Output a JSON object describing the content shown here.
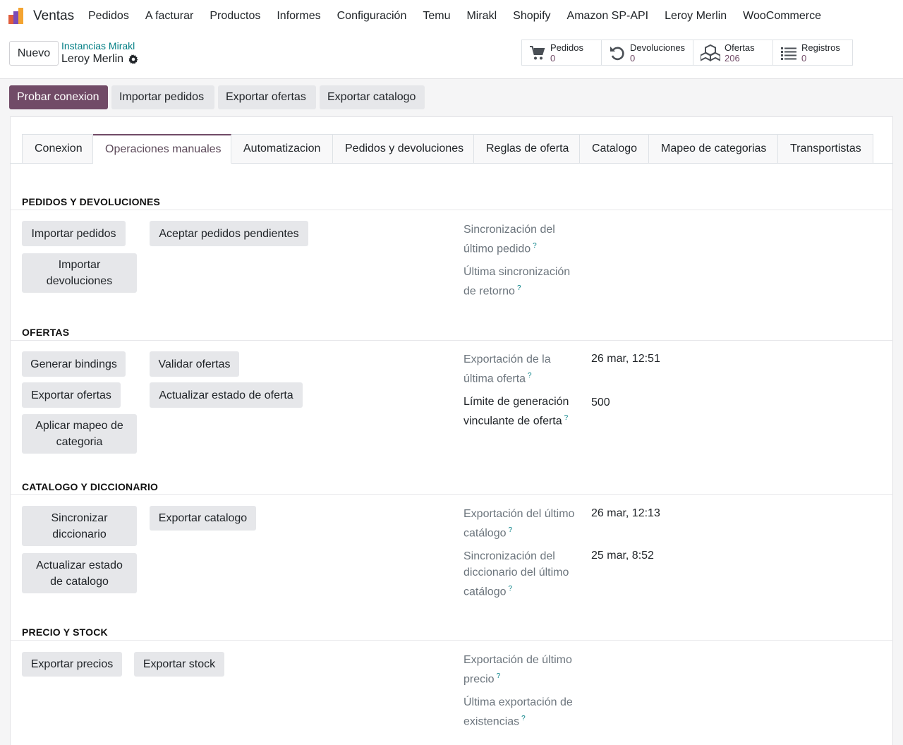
{
  "topbar": {
    "app_name": "Ventas",
    "menu": [
      "Pedidos",
      "A facturar",
      "Productos",
      "Informes",
      "Configuración",
      "Temu",
      "Mirakl",
      "Shopify",
      "Amazon SP-API",
      "Leroy Merlin",
      "WooCommerce"
    ]
  },
  "controlpanel": {
    "new_button": "Nuevo",
    "breadcrumb_parent": "Instancias Mirakl",
    "breadcrumb_current": "Leroy Merlin",
    "smart_buttons": [
      {
        "label": "Pedidos",
        "value": "0",
        "icon": "cart-icon"
      },
      {
        "label": "Devoluciones",
        "value": "0",
        "icon": "undo-icon"
      },
      {
        "label": "Ofertas",
        "value": "206",
        "icon": "cubes-icon"
      },
      {
        "label": "Registros",
        "value": "0",
        "icon": "list-icon"
      }
    ]
  },
  "header_buttons": [
    "Probar conexion",
    "Importar pedidos",
    "Exportar ofertas",
    "Exportar catalogo"
  ],
  "tabs": [
    "Conexion",
    "Operaciones manuales",
    "Automatizacion",
    "Pedidos y devoluciones",
    "Reglas de oferta",
    "Catalogo",
    "Mapeo de categorias",
    "Transportistas"
  ],
  "active_tab": "Operaciones manuales",
  "sections": {
    "orders": {
      "title": "PEDIDOS Y DEVOLUCIONES",
      "buttons": [
        "Importar pedidos",
        "Aceptar pedidos pendientes",
        "Importar devoluciones"
      ],
      "fields": [
        {
          "label": "Sincronización del último pedido",
          "value": ""
        },
        {
          "label": "Última sincronización de retorno",
          "value": ""
        }
      ]
    },
    "offers": {
      "title": "OFERTAS",
      "buttons": [
        "Generar bindings",
        "Validar ofertas",
        "Exportar ofertas",
        "Actualizar estado de oferta",
        "Aplicar mapeo de categoria"
      ],
      "fields": [
        {
          "label": "Exportación de la última oferta",
          "value": "26 mar, 12:51"
        },
        {
          "label": "Límite de generación vinculante de oferta",
          "value": "500"
        }
      ]
    },
    "catalog": {
      "title": "CATALOGO Y DICCIONARIO",
      "buttons": [
        "Sincronizar diccionario",
        "Exportar catalogo",
        "Actualizar estado de catalogo"
      ],
      "fields": [
        {
          "label": "Exportación del último catálogo",
          "value": "26 mar, 12:13"
        },
        {
          "label": "Sincronización del diccionario del último catálogo",
          "value": "25 mar, 8:52"
        }
      ]
    },
    "stock": {
      "title": "PRECIO Y STOCK",
      "buttons": [
        "Exportar precios",
        "Exportar stock"
      ],
      "fields": [
        {
          "label": "Exportación de último precio",
          "value": ""
        },
        {
          "label": "Última exportación de existencias",
          "value": ""
        }
      ]
    }
  },
  "help_marker": "?",
  "colors": {
    "brand": "#714b67",
    "link": "#017e84",
    "button_bg": "#e6e7ea"
  }
}
